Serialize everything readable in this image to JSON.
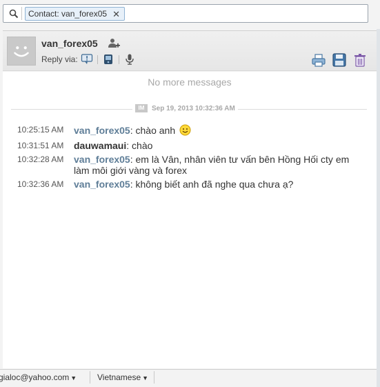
{
  "search": {
    "token_label": "Contact: van_forex05",
    "token_close": "✕"
  },
  "contact": {
    "name": "van_forex05",
    "reply_via_label": "Reply via:"
  },
  "messages": {
    "no_more_label": "No more messages",
    "divider_badge": "IM",
    "divider_date": "Sep 19, 2013 10:32:36 AM",
    "items": [
      {
        "time": "10:25:15 AM",
        "sender": "van_forex05",
        "text": ": chào anh",
        "emoticon": "smiley-icon"
      },
      {
        "time": "10:31:51 AM",
        "sender": "dauwamaui",
        "text": ": chào"
      },
      {
        "time": "10:32:28 AM",
        "sender": "van_forex05",
        "text": ": em là Vân, nhân viên tư vấn bên Hồng Hối cty em làm môi giới vàng và forex"
      },
      {
        "time": "10:32:36 AM",
        "sender": "van_forex05",
        "text": ": không biết anh đã nghe qua chưa ạ?"
      }
    ]
  },
  "status_bar": {
    "account": "gialoc@yahoo.com",
    "language": "Vietnamese"
  },
  "colors": {
    "sender_them": "#5e7d97",
    "token_bg": "#e7f0f9",
    "token_border": "#8fb2d3"
  },
  "icons": [
    "search-icon",
    "add-contact-icon",
    "im-reply-icon",
    "sms-reply-icon",
    "voice-reply-icon",
    "print-icon",
    "save-icon",
    "delete-icon",
    "smiley-icon"
  ]
}
